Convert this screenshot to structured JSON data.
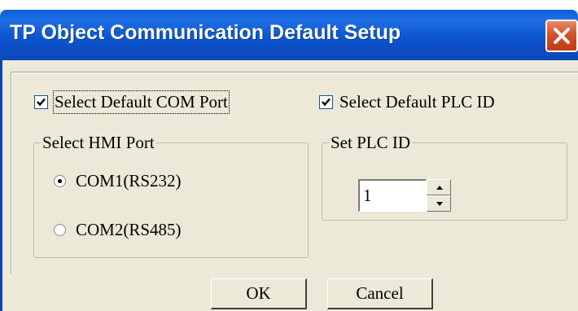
{
  "window": {
    "title": "TP Object Communication Default Setup",
    "close_icon": "close-icon"
  },
  "options": {
    "default_com_port": {
      "label": "Select Default COM Port",
      "checked": true
    },
    "default_plc_id": {
      "label": "Select Default PLC ID",
      "checked": true
    }
  },
  "hmi_port_group": {
    "legend": "Select HMI Port",
    "options": [
      {
        "label": "COM1(RS232)",
        "selected": true
      },
      {
        "label": "COM2(RS485)",
        "selected": false
      }
    ]
  },
  "plc_id_group": {
    "legend": "Set PLC ID",
    "value": "1",
    "up_icon": "arrow-up-icon",
    "down_icon": "arrow-down-icon"
  },
  "buttons": {
    "ok": "OK",
    "cancel": "Cancel"
  },
  "colors": {
    "titlebar": "#0c55d0",
    "close": "#d4512a",
    "dialog_bg": "#ece9d8"
  }
}
